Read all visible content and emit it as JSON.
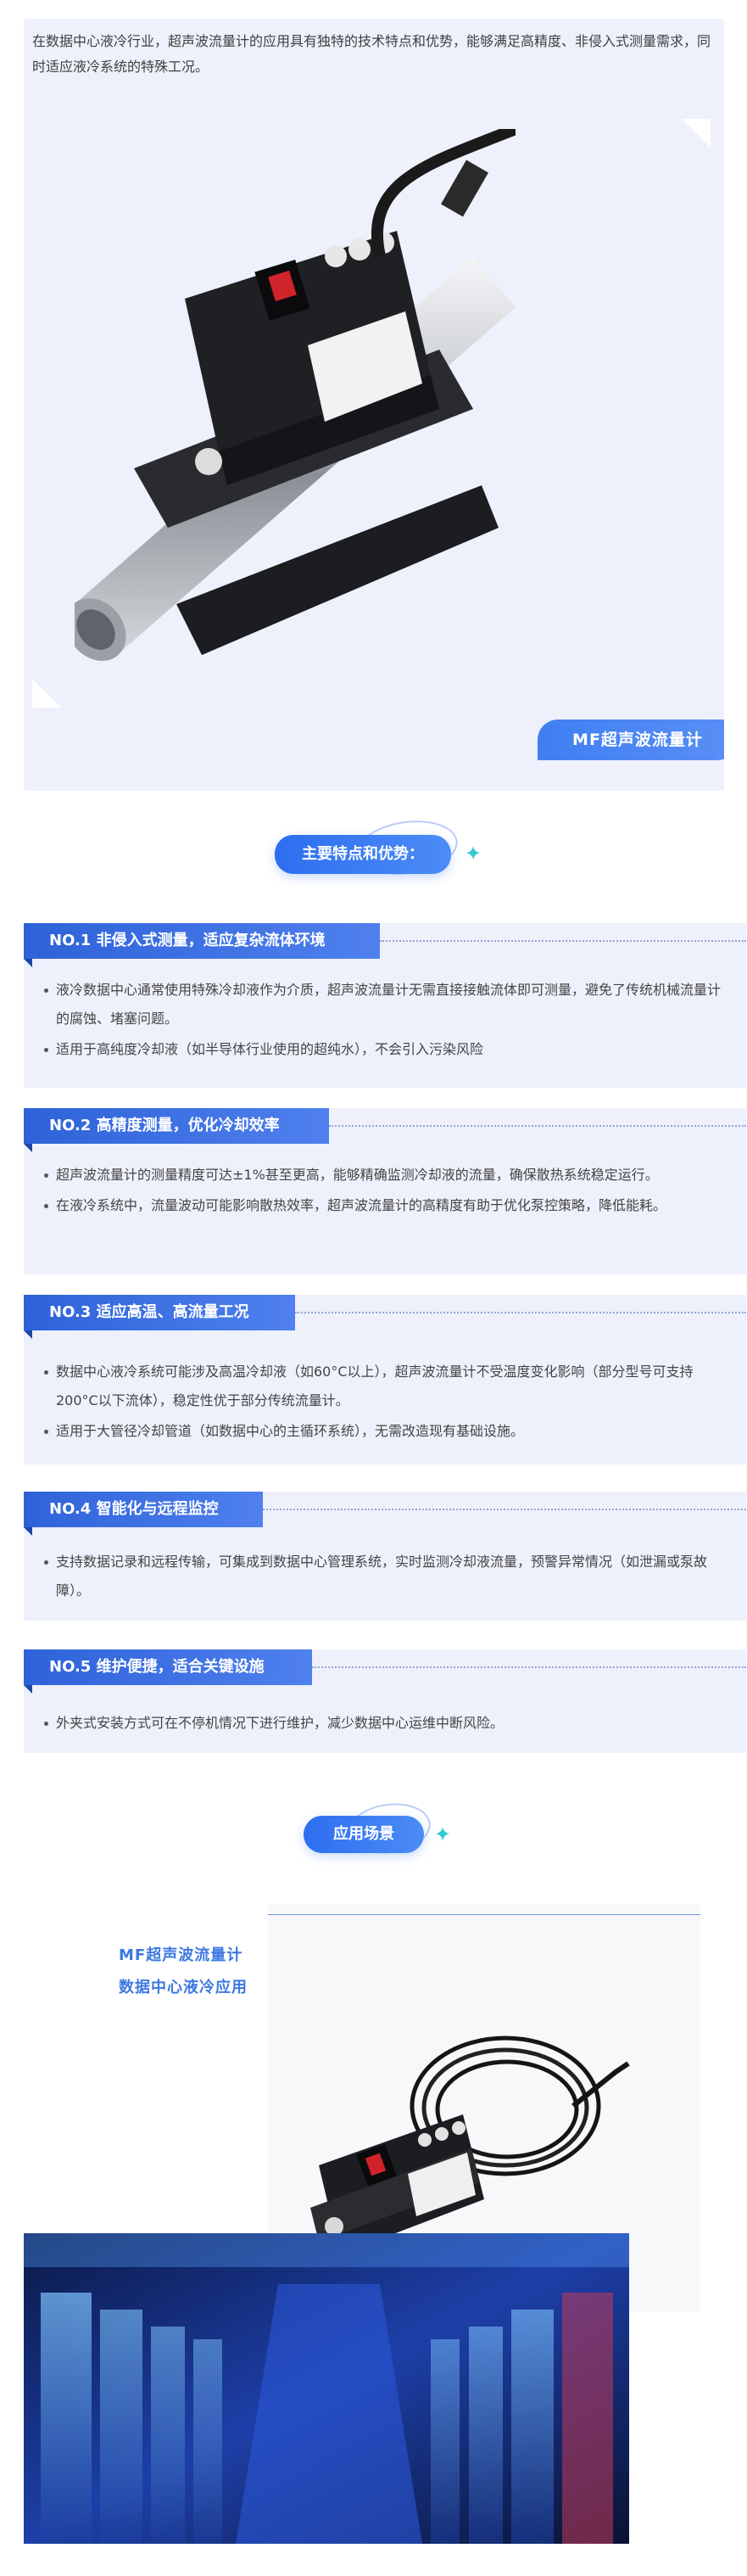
{
  "intro": {
    "text": "在数据中心液冷行业，超声波流量计的应用具有独特的技术特点和优势，能够满足高精度、非侵入式测量需求，同时适应液冷系统的特殊工况。",
    "product_badge": "MF超声波流量计"
  },
  "features_heading": "主要特点和优势：",
  "sections": [
    {
      "title": "NO.1  非侵入式测量，适应复杂流体环境",
      "items": [
        "液冷数据中心通常使用特殊冷却液作为介质，超声波流量计无需直接接触流体即可测量，避免了传统机械流量计的腐蚀、堵塞问题。",
        "适用于高纯度冷却液（如半导体行业使用的超纯水），不会引入污染风险"
      ]
    },
    {
      "title": "NO.2  高精度测量，优化冷却效率",
      "items": [
        "超声波流量计的测量精度可达±1%甚至更高，能够精确监测冷却液的流量，确保散热系统稳定运行。",
        "在液冷系统中，流量波动可能影响散热效率，超声波流量计的高精度有助于优化泵控策略，降低能耗。"
      ]
    },
    {
      "title": "NO.3  适应高温、高流量工况",
      "items": [
        "数据中心液冷系统可能涉及高温冷却液（如60°C以上），超声波流量计不受温度变化影响（部分型号可支持200°C以下流体），稳定性优于部分传统流量计。",
        "适用于大管径冷却管道（如数据中心的主循环系统），无需改造现有基础设施。"
      ]
    },
    {
      "title": "NO.4  智能化与远程监控",
      "items": [
        "支持数据记录和远程传输，可集成到数据中心管理系统，实时监测冷却液流量，预警异常情况（如泄漏或泵故障）。"
      ]
    },
    {
      "title": "NO.5  维护便捷，适合关键设施",
      "items": [
        "外夹式安装方式可在不停机情况下进行维护，减少数据中心运维中断风险。"
      ]
    }
  ],
  "application": {
    "heading": "应用场景",
    "title_line1": "MF超声波流量计",
    "title_line2": "数据中心液冷应用"
  },
  "colors": {
    "accent": "#2e62d8",
    "panel": "#eef1fb",
    "app_title": "#3e78e0"
  },
  "icons": [
    "sparkle-icon",
    "bullet-dot-icon"
  ]
}
